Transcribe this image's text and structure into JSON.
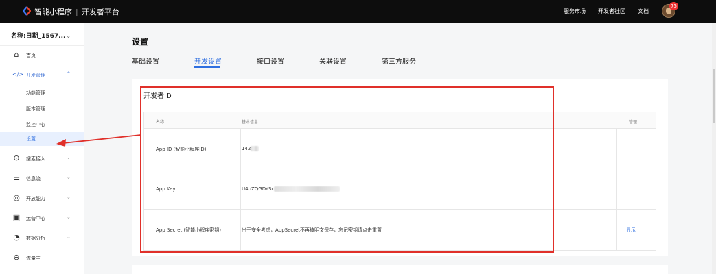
{
  "topbar": {
    "brand_name": "智能小程序",
    "brand_sub": "开发者平台",
    "links": [
      "服务市场",
      "开发者社区",
      "文档"
    ],
    "notice_count": "75"
  },
  "sidebar": {
    "account": "名称:日期_1567...",
    "items": [
      {
        "label": "首页",
        "icon": "home-icon"
      },
      {
        "label": "开发管理",
        "icon": "code-icon",
        "open": true
      },
      {
        "label": "搜索接入",
        "icon": "search-icon"
      },
      {
        "label": "信息流",
        "icon": "feed-icon"
      },
      {
        "label": "开放能力",
        "icon": "capability-icon"
      },
      {
        "label": "运营中心",
        "icon": "operation-icon"
      },
      {
        "label": "数据分析",
        "icon": "analytics-icon"
      },
      {
        "label": "流量主",
        "icon": "traffic-icon"
      }
    ],
    "sub_items": [
      "功能管理",
      "版本管理",
      "监控中心",
      "设置"
    ]
  },
  "main": {
    "title": "设置",
    "tabs": [
      "基础设置",
      "开发设置",
      "接口设置",
      "关联设置",
      "第三方服务"
    ],
    "active_tab": "开发设置",
    "card_title": "开发者ID",
    "table": {
      "headers": [
        "名称",
        "基本信息",
        "管理"
      ],
      "rows": [
        {
          "name": "App ID (智能小程序ID)",
          "value": "142",
          "action": ""
        },
        {
          "name": "App Key",
          "value": "U4uZQGDYSc",
          "action": ""
        },
        {
          "name": "App Secret (智能小程序密钥)",
          "value": "出于安全考虑，AppSecret不再被明文保存，忘记密钥请点击重置",
          "action": "显示"
        }
      ]
    }
  },
  "colors": {
    "accent": "#2f6fe0",
    "annotation": "#e0302a",
    "topbar": "#0d0d0d"
  }
}
